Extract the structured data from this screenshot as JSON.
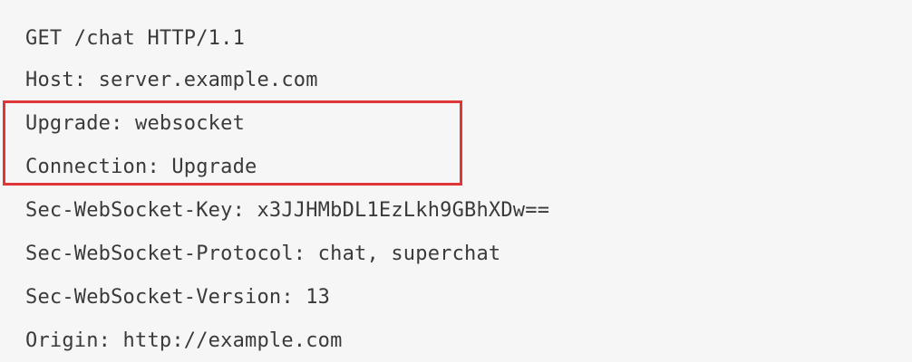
{
  "request": {
    "lines": [
      "GET /chat HTTP/1.1",
      "Host: server.example.com",
      "Upgrade: websocket",
      "Connection: Upgrade",
      "Sec-WebSocket-Key: x3JJHMbDL1EzLkh9GBhXDw==",
      "Sec-WebSocket-Protocol: chat, superchat",
      "Sec-WebSocket-Version: 13",
      "Origin: http://example.com"
    ]
  },
  "highlight": {
    "color": "#e0363a"
  }
}
